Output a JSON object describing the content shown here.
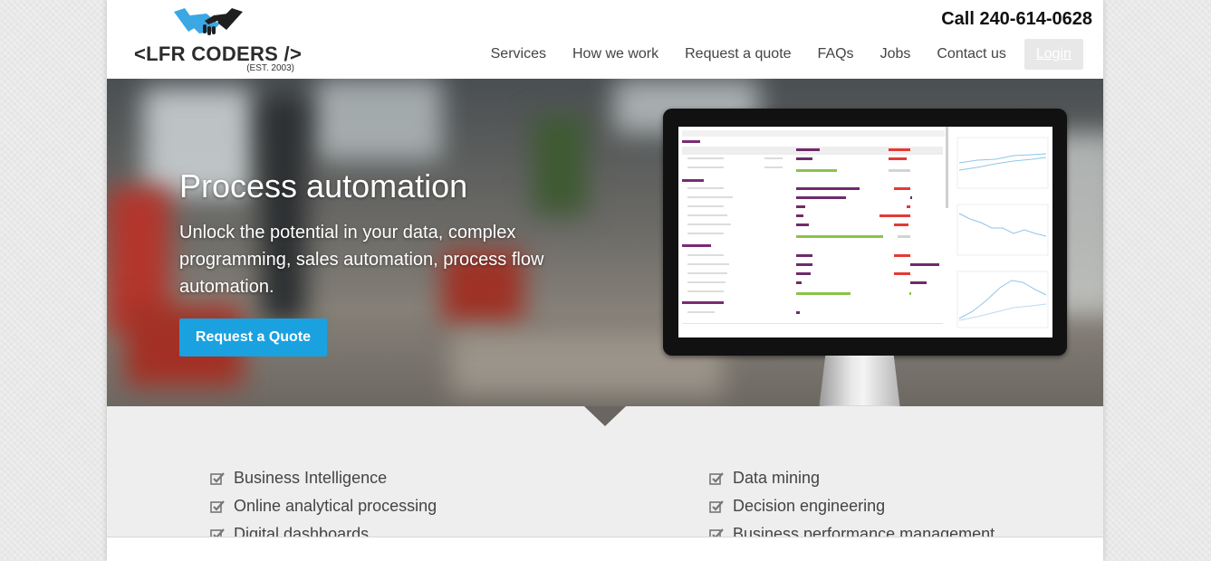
{
  "header": {
    "logo_text": "<LFR CODERS />",
    "logo_est": "(EST. 2003)",
    "phone": "Call 240-614-0628",
    "nav": [
      "Services",
      "How we work",
      "Request a quote",
      "FAQs",
      "Jobs",
      "Contact us"
    ],
    "login_label": "Login"
  },
  "hero": {
    "title": "Process automation",
    "subtitle": "Unlock the potential in your data, complex programming, sales automation, process flow automation.",
    "cta_label": "Request a Quote"
  },
  "features": {
    "left": [
      "Business Intelligence",
      "Online analytical processing",
      "Digital dashboards"
    ],
    "right": [
      "Data mining",
      "Decision engineering",
      "Business performance management"
    ]
  },
  "colors": {
    "accent": "#1aa1e0",
    "logo_left_hand": "#3ba7e3",
    "logo_right_hand": "#1f1f1f",
    "dash_purple": "#6e2b6b",
    "dash_red": "#e53935",
    "dash_green": "#8bc34a"
  }
}
